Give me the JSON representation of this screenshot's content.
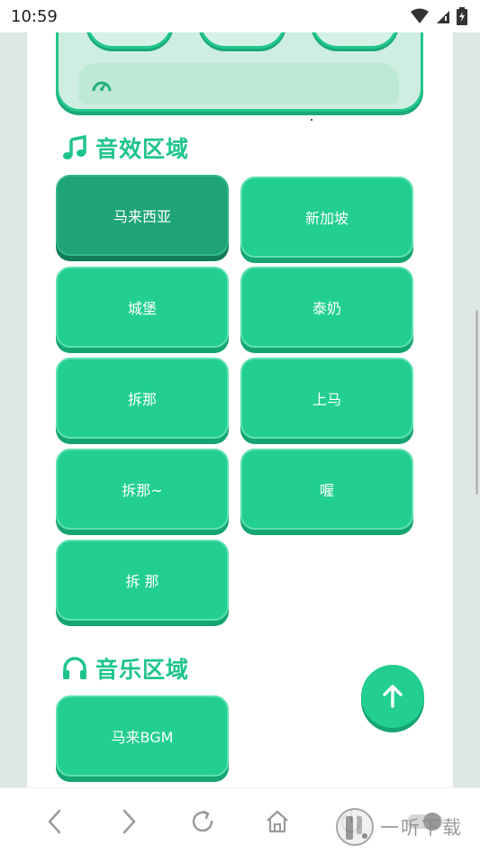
{
  "status_bar": {
    "time": "10:59"
  },
  "colors": {
    "accent": "#22cf8f",
    "accent_dark": "#15a571",
    "active_button": "#1ea476",
    "heading": "#1fc48a"
  },
  "sections": {
    "sound_effects": {
      "icon": "music-note-icon",
      "title": "音效区域",
      "buttons": [
        "马来西亚",
        "新加坡",
        "城堡",
        "泰奶",
        "拆那",
        "上马",
        "拆那~",
        "喔",
        "拆 那"
      ],
      "active_index": 0
    },
    "music": {
      "icon": "headphones-icon",
      "title": "音乐区域",
      "buttons": [
        "马来BGM"
      ]
    }
  },
  "fab": {
    "icon": "arrow-up-icon"
  },
  "bottom_nav": {
    "items": [
      "back-icon",
      "forward-icon",
      "reload-icon",
      "home-icon",
      "power-icon",
      "toggle-icon"
    ]
  },
  "watermark": {
    "text": "一听下载"
  }
}
